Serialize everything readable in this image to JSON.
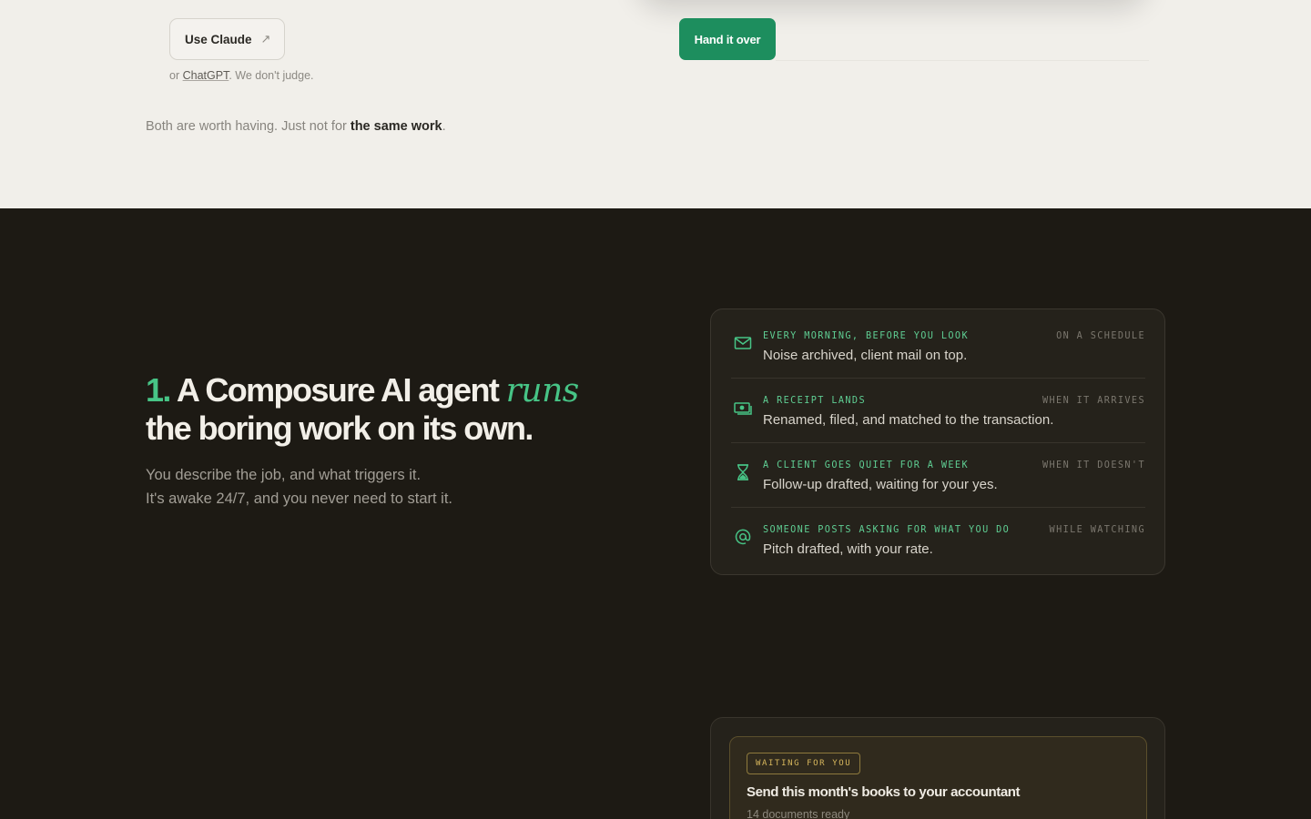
{
  "top": {
    "claude_button": "Use Claude",
    "claude_arrow": "↗",
    "or_prefix": "or ",
    "chatgpt_link": "ChatGPT",
    "or_suffix": ". We don't judge.",
    "both_prefix": "Both are worth having. Just not for ",
    "both_bold": "the same work",
    "both_suffix": ".",
    "hand_button": "Hand it over"
  },
  "section": {
    "headline_num": "1.",
    "headline_a": " A Composure AI agent ",
    "headline_italic": "runs",
    "headline_b": "the boring work on its own.",
    "sub_line1": "You describe the job, and what triggers it.",
    "sub_line2": "It's awake 24/7, and you never need to start it."
  },
  "triggers": [
    {
      "icon": "mail-icon",
      "trigger": "EVERY MORNING, BEFORE YOU LOOK",
      "when": "ON A SCHEDULE",
      "result": "Noise archived, client mail on top."
    },
    {
      "icon": "cash-icon",
      "trigger": "A RECEIPT LANDS",
      "when": "WHEN IT ARRIVES",
      "result": "Renamed, filed, and matched to the transaction."
    },
    {
      "icon": "hourglass-icon",
      "trigger": "A CLIENT GOES QUIET FOR A WEEK",
      "when": "WHEN IT DOESN'T",
      "result": "Follow-up drafted, waiting for your yes."
    },
    {
      "icon": "at-sign-icon",
      "trigger": "SOMEONE POSTS ASKING FOR WHAT YOU DO",
      "when": "WHILE WATCHING",
      "result": "Pitch drafted, with your rate."
    }
  ],
  "task_card": {
    "badge": "WAITING FOR YOU",
    "title": "Send this month's books to your accountant",
    "subtitle": "14 documents ready"
  },
  "colors": {
    "accent": "#47c486",
    "button_green": "#1d8e5e",
    "dark_bg": "#1d1a14",
    "light_bg": "#f1efea",
    "badge_gold": "#d6b65c"
  }
}
